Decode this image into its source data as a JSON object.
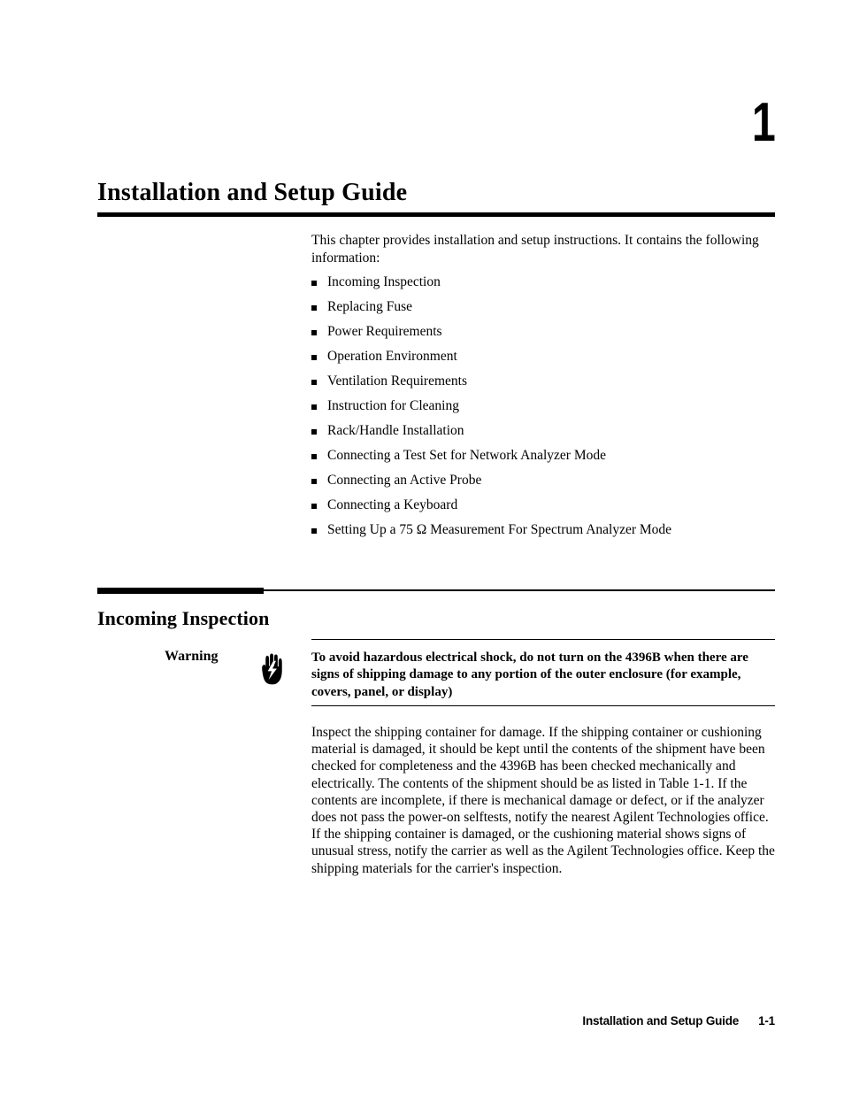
{
  "page": {
    "chapter_number": "1",
    "chapter_title": "Installation and Setup Guide",
    "intro_paragraph": "This chapter provides installation and setup instructions. It contains the following information:",
    "bullets": [
      "Incoming Inspection",
      "Replacing Fuse",
      "Power Requirements",
      "Operation Environment",
      "Ventilation Requirements",
      "Instruction for Cleaning",
      "Rack/Handle Installation",
      "Connecting a Test Set for Network Analyzer Mode",
      "Connecting an Active Probe",
      "Connecting a Keyboard",
      "Setting Up a 75 Ω Measurement For Spectrum Analyzer Mode"
    ],
    "section": {
      "title": "Incoming Inspection",
      "warning": {
        "label": "Warning",
        "icon": "electric-shock-hand-icon",
        "text": "To avoid hazardous electrical shock, do not turn on the 4396B when there are signs of shipping damage to any portion of the outer enclosure (for example, covers, panel, or display)"
      },
      "body_paragraph": "Inspect the shipping container for damage. If the shipping container or cushioning material is damaged, it should be kept until the contents of the shipment have been checked for completeness and the 4396B has been checked mechanically and electrically. The contents of the shipment should be as listed in Table 1-1. If the contents are incomplete, if there is mechanical damage or defect, or if the analyzer does not pass the power-on selftests, notify the nearest Agilent Technologies office. If the shipping container is damaged, or the cushioning material shows signs of unusual stress, notify the carrier as well as the Agilent Technologies office. Keep the shipping materials for the carrier's inspection."
    },
    "footer": {
      "title": "Installation and Setup Guide",
      "page_number": "1-1"
    },
    "colors": {
      "text": "#000000",
      "background": "#ffffff",
      "rule": "#000000"
    }
  }
}
